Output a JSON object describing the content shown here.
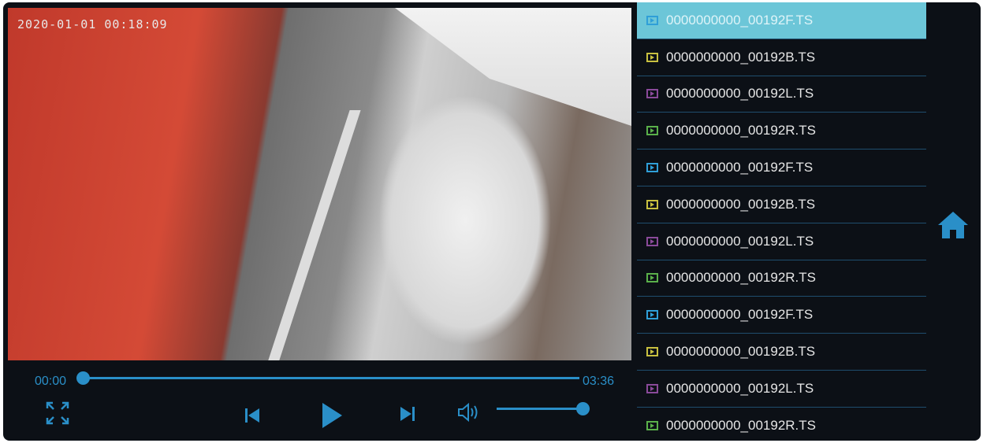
{
  "video": {
    "timestamp": "2020-01-01 00:18:09"
  },
  "player": {
    "current_time": "00:00",
    "duration": "03:36",
    "progress": 0.0,
    "volume": 1.0
  },
  "colors": {
    "accent": "#2a8fc8",
    "selected_row": "#6cc6d8",
    "F": "#2f9fd8",
    "B": "#c8c040",
    "L": "#8a4a9a",
    "R": "#5ab04a"
  },
  "files": [
    {
      "name": "0000000000_00192F.TS",
      "type": "F"
    },
    {
      "name": "0000000000_00192B.TS",
      "type": "B"
    },
    {
      "name": "0000000000_00192L.TS",
      "type": "L"
    },
    {
      "name": "0000000000_00192R.TS",
      "type": "R"
    },
    {
      "name": "0000000000_00192F.TS",
      "type": "F"
    },
    {
      "name": "0000000000_00192B.TS",
      "type": "B"
    },
    {
      "name": "0000000000_00192L.TS",
      "type": "L"
    },
    {
      "name": "0000000000_00192R.TS",
      "type": "R"
    },
    {
      "name": "0000000000_00192F.TS",
      "type": "F"
    },
    {
      "name": "0000000000_00192B.TS",
      "type": "B"
    },
    {
      "name": "0000000000_00192L.TS",
      "type": "L"
    },
    {
      "name": "0000000000_00192R.TS",
      "type": "R"
    }
  ],
  "selected_index": 0
}
